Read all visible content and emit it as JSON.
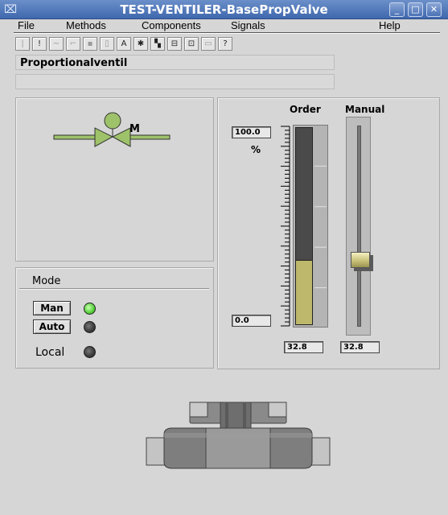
{
  "window": {
    "title": "TEST-VENTILER-BasePropValve",
    "minimize_glyph": "_",
    "maximize_glyph": "□",
    "close_glyph": "✕"
  },
  "menu": {
    "items": [
      "File",
      "Methods",
      "Components",
      "Signals",
      "Help"
    ]
  },
  "toolbar": {
    "buttons": [
      "|",
      "!",
      "~",
      "⌐",
      "▪",
      "▯",
      "A",
      "✱",
      "▚",
      "⊟",
      "⊡",
      "▭",
      "?"
    ]
  },
  "description": {
    "name": "Proportionalventil",
    "extra": ""
  },
  "valve": {
    "motor_label": "M",
    "colors": {
      "valve_body": "#9ec26a",
      "pipe": "#9ec26a"
    }
  },
  "mode": {
    "title": "Mode",
    "man_label": "Man",
    "auto_label": "Auto",
    "local_label": "Local",
    "man_active": true,
    "auto_active": false,
    "local_active": false
  },
  "order": {
    "title": "Order",
    "scale_max": "100.0",
    "scale_min": "0.0",
    "unit": "%",
    "value": "32.8",
    "fraction": 0.328,
    "fill_color": "#bdb86c"
  },
  "manual": {
    "title": "Manual",
    "value": "32.8",
    "fraction": 0.328
  }
}
